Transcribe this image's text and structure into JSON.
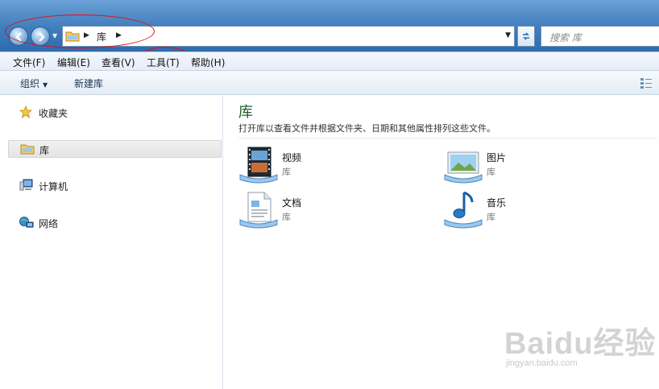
{
  "address_bar": {
    "crumb": "库",
    "search_placeholder": "搜索 库"
  },
  "menu": {
    "items": [
      "文件(F)",
      "编辑(E)",
      "查看(V)",
      "工具(T)",
      "帮助(H)"
    ]
  },
  "toolbar": {
    "organize_label": "组织",
    "new_library_label": "新建库"
  },
  "nav_pane": {
    "items": [
      {
        "label": "收藏夹",
        "icon": "star-icon"
      },
      {
        "label": "库",
        "icon": "library-folder-icon",
        "selected": true
      },
      {
        "label": "计算机",
        "icon": "computer-icon"
      },
      {
        "label": "网络",
        "icon": "network-icon"
      }
    ]
  },
  "content": {
    "title": "库",
    "description": "打开库以查看文件并根据文件夹、日期和其他属性排列这些文件。",
    "libraries": [
      {
        "name": "视频",
        "type": "库",
        "icon": "video-library-icon"
      },
      {
        "name": "图片",
        "type": "库",
        "icon": "pictures-library-icon"
      },
      {
        "name": "文档",
        "type": "库",
        "icon": "documents-library-icon"
      },
      {
        "name": "音乐",
        "type": "库",
        "icon": "music-library-icon"
      }
    ]
  },
  "watermark": {
    "main": "Baidu经验",
    "sub": "jingyan.baidu.com"
  },
  "colors": {
    "title_gradient_top": "#6aa2d8",
    "title_gradient_bottom": "#2e6cb0",
    "library_title": "#1c5e27",
    "annotation_red": "#e01010"
  }
}
